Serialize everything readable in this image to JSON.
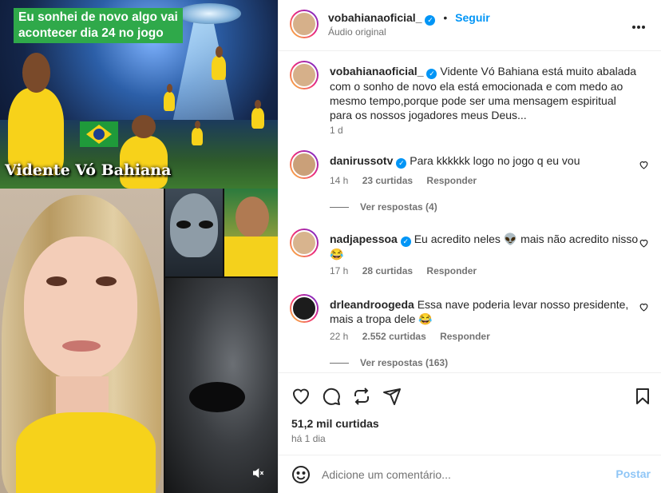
{
  "media": {
    "headline": "Eu sonhei de novo algo vai acontecer dia 24 no jogo",
    "caption_overlay": "Vidente Vó Bahiana"
  },
  "header": {
    "username": "vobahianaoficial_",
    "separator": "•",
    "follow_label": "Seguir",
    "audio": "Áudio original",
    "more_icon": "more-horizontal-icon"
  },
  "caption": {
    "username": "vobahianaoficial_",
    "text": "Vidente Vó Bahiana está muito abalada com o sonho de novo ela está emocionada e com medo ao mesmo tempo,porque pode ser uma mensagem espiritual para os nossos jogadores meus Deus...",
    "age": "1 d"
  },
  "comments": [
    {
      "username": "danirussotv",
      "verified": true,
      "text": "Para kkkkkk logo no jogo q eu vou",
      "age": "14 h",
      "likes": "23 curtidas",
      "reply": "Responder",
      "view_replies": "Ver respostas (4)"
    },
    {
      "username": "nadjapessoa",
      "verified": true,
      "text": "Eu acredito neles 👽 mais não acredito nisso 😂",
      "age": "17 h",
      "likes": "28 curtidas",
      "reply": "Responder"
    },
    {
      "username": "drleandroogeda",
      "verified": false,
      "text": "Essa nave poderia levar nosso presidente, mais a tropa dele 😂",
      "age": "22 h",
      "likes": "2.552 curtidas",
      "reply": "Responder",
      "view_replies": "Ver respostas (163)"
    }
  ],
  "actions": {
    "likes": "51,2 mil curtidas",
    "posted": "há 1 dia",
    "icons": [
      "heart-icon",
      "comment-icon",
      "share-icon",
      "send-icon",
      "bookmark-icon"
    ]
  },
  "compose": {
    "placeholder": "Adicione um comentário...",
    "post_label": "Postar"
  }
}
